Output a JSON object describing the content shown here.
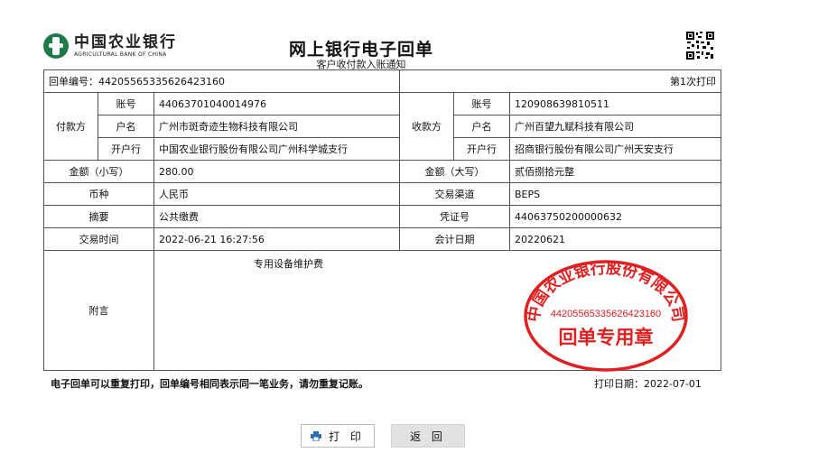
{
  "bank": {
    "name_cn": "中国农业银行",
    "name_en": "AGRICULTURAL BANK OF CHINA"
  },
  "header": {
    "title": "网上银行电子回单",
    "subtitle": "客户收付款入账通知"
  },
  "receipt": {
    "number_label": "回单编号：",
    "number": "44205565335626423160",
    "print_count": "第1次打印",
    "payer": {
      "section": "付款方",
      "account_label": "账号",
      "account": "44063701040014976",
      "name_label": "户名",
      "name": "广州市斑奇迹生物科技有限公司",
      "bank_label": "开户行",
      "bank": "中国农业银行股份有限公司广州科学城支行"
    },
    "payee": {
      "section": "收款方",
      "account_label": "账号",
      "account": "120908639810511",
      "name_label": "户名",
      "name": "广州百望九赋科技有限公司",
      "bank_label": "开户行",
      "bank": "招商银行股份有限公司广州天安支行"
    },
    "amount_small_label": "金额（小写）",
    "amount_small": "280.00",
    "amount_big_label": "金额（大写）",
    "amount_big": "贰佰捌拾元整",
    "currency_label": "币种",
    "currency": "人民币",
    "channel_label": "交易渠道",
    "channel": "BEPS",
    "summary_label": "摘要",
    "summary": "公共缴费",
    "voucher_label": "凭证号",
    "voucher": "44063750200000632",
    "time_label": "交易时间",
    "time": "2022-06-21 16:27:56",
    "acct_date_label": "会计日期",
    "acct_date": "20220621",
    "note_label": "附言",
    "note": "专用设备维护费"
  },
  "stamp": {
    "org": "中国农业银行股份有限公司",
    "number": "44205565335626423160",
    "purpose": "回单专用章",
    "color": "#e02020"
  },
  "footer": {
    "note": "电子回单可以重复打印，回单编号相同表示同一笔业务，请勿重复记账。",
    "print_date_label": "打印日期：",
    "print_date": "2022-07-01"
  },
  "buttons": {
    "print": "打 印",
    "back": "返 回"
  }
}
